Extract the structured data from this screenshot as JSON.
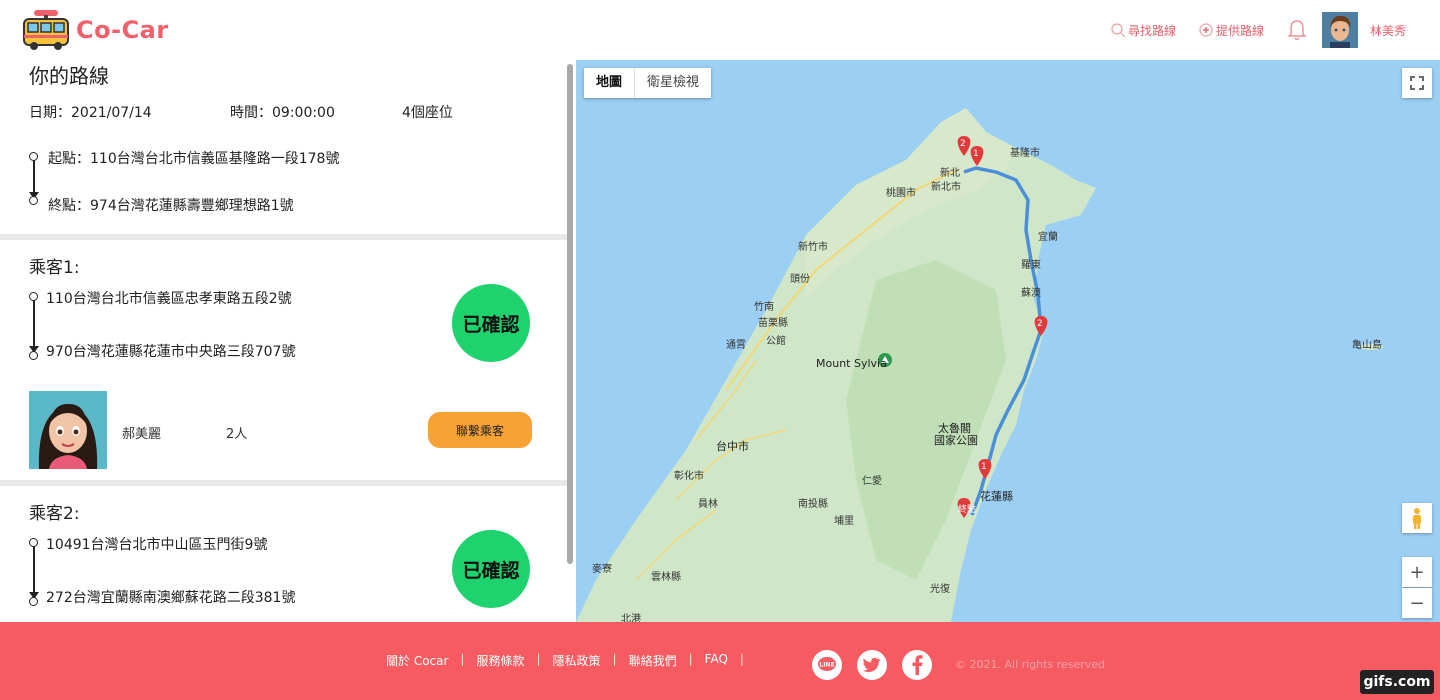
{
  "app": {
    "logo_text": "Co-Car"
  },
  "nav": {
    "find_route": "尋找路線",
    "offer_route": "提供路線",
    "user_name": "林美秀"
  },
  "route": {
    "title": "你的路線",
    "date": "日期：2021/07/14",
    "time": "時間：09:00:00",
    "seats": "4個座位",
    "start": "起點：110台灣台北市信義區基隆路一段178號",
    "end": "終點：974台灣花蓮縣壽豐鄉理想路1號"
  },
  "passengers": [
    {
      "label": "乘客1:",
      "from": "110台灣台北市信義區忠孝東路五段2號",
      "to": "970台灣花蓮縣花蓮市中央路三段707號",
      "status": "已確認",
      "name": "郝美麗",
      "count": "2人",
      "contact": "聯繫乘客"
    },
    {
      "label": "乘客2:",
      "from": "10491台灣台北市中山區玉門街9號",
      "to": "272台灣宜蘭縣南澳鄉蘇花路二段381號",
      "status": "已確認"
    }
  ],
  "map": {
    "tab_map": "地圖",
    "tab_satellite": "衛星檢視",
    "labels": {
      "keelung": "基隆市",
      "newtaipei": "新北",
      "newtaipei_city": "新北市",
      "taoyuan": "桃園市",
      "hsinchu": "新竹市",
      "miaoli": "苗栗縣",
      "miaoli_city": "苗栗",
      "gongguan": "公館",
      "toufen": "頭份",
      "zhunan": "竹南",
      "tongxiao": "通霄",
      "taichung": "台中市",
      "changhua": "彰化市",
      "yuanlin": "員林",
      "nantou": "南投縣",
      "puli": "埔里",
      "renai": "仁愛",
      "mountain": "Mount Sylvia",
      "taroko": "太魯閣",
      "park": "國家公園",
      "hualien": "花蓮縣",
      "hualien_city": "花",
      "yilan": "宜蘭",
      "luodong": "羅東",
      "suao": "蘇澳",
      "yunlin": "雲林縣",
      "mailiao": "麥寮",
      "chiayi": "北港",
      "guangfu": "光復",
      "turtle": "亀山島",
      "end_marker": "終點",
      "marker1": "1",
      "marker2": "2"
    },
    "zoom_in": "+",
    "zoom_out": "−"
  },
  "footer": {
    "about": "關於 Cocar",
    "terms": "服務條款",
    "privacy": "隱私政策",
    "contact": "聯絡我們",
    "faq": "FAQ",
    "copyright": "© 2021. All rights reserved",
    "social_line": "LINE"
  },
  "watermark": "gifs.com",
  "colors": {
    "brand": "#f65b62",
    "confirmed": "#1ed26e",
    "contact_button": "#f7a235",
    "map_sea": "#9ccff4",
    "map_land": "#cfe7c8",
    "route_line": "#4a8fd8",
    "marker": "#e03a3a"
  }
}
